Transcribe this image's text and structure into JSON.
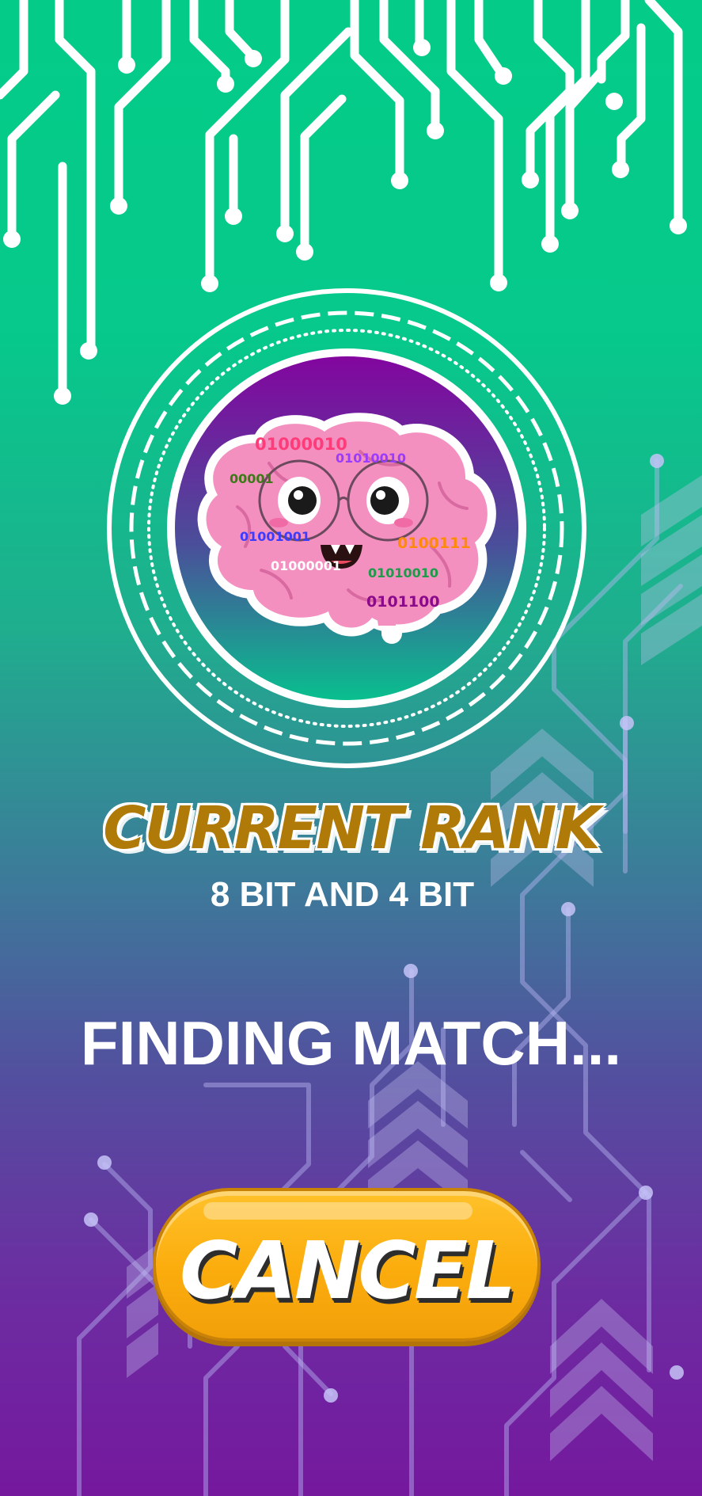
{
  "rank": {
    "title": "CURRENT RANK",
    "value": "8 BIT AND 4 BIT"
  },
  "status": {
    "text": "FINDING MATCH..."
  },
  "cancel_button": {
    "label": "CANCEL"
  },
  "avatar": {
    "icon": "brain-mascot-icon",
    "binary_labels": [
      "01000010",
      "01010010",
      "00001",
      "01001001",
      "0100111",
      "01000001",
      "01010010",
      "0101100"
    ]
  },
  "colors": {
    "background_top": "#04cc88",
    "background_bottom": "#75189e",
    "rank_title": "#b07a08",
    "cancel_button": "#fbac0c",
    "brain": "#f490c0"
  }
}
